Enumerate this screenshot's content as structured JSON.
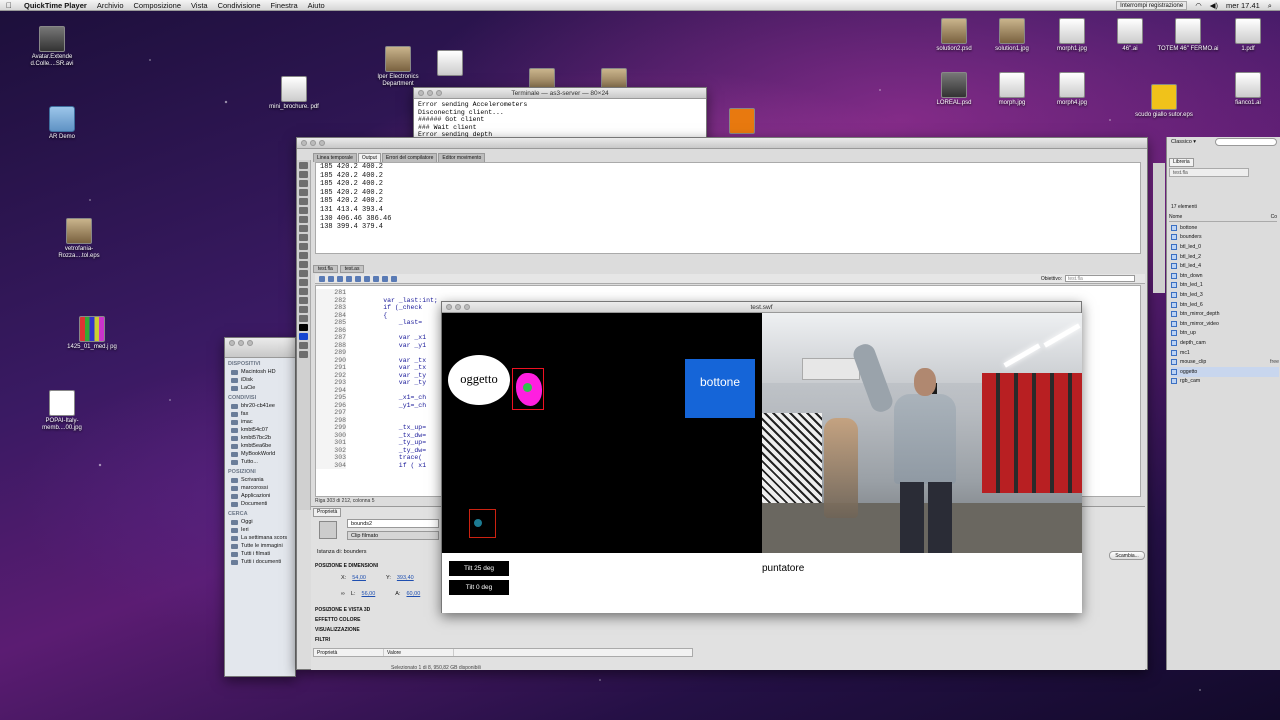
{
  "menubar": {
    "app": "QuickTime Player",
    "items": [
      "Archivio",
      "Composizione",
      "Vista",
      "Condivisione",
      "Finestra",
      "Aiuto"
    ],
    "notice": "Interrompi registrazione",
    "clock": "mer 17.41"
  },
  "desktop_icons": [
    {
      "label": "Avatar.Extende d.Colle....SR.avi"
    },
    {
      "label": "AR Demo"
    },
    {
      "label": "mini_brochure. pdf"
    },
    {
      "label": "Iper Electronics Department"
    },
    {
      "label": "vetrofania-Rozza....tol.eps"
    },
    {
      "label": "1425_01_med.j pg"
    },
    {
      "label": "POPAI-Italy-memb....00.jpg"
    },
    {
      "label": "solution2.psd"
    },
    {
      "label": "solution1.jpg"
    },
    {
      "label": "morph1.jpg"
    },
    {
      "label": "46\".ai"
    },
    {
      "label": "TOTEM 46\" FERMO.ai"
    },
    {
      "label": "1.pdf"
    },
    {
      "label": "LOREAL.psd"
    },
    {
      "label": "morph.jpg"
    },
    {
      "label": "morph4.jpg"
    },
    {
      "label": "scudo giallo sutor.eps"
    },
    {
      "label": "fianco1.ai"
    }
  ],
  "terminal": {
    "title": "Terminale — as3-server — 80×24",
    "lines": "Error sending Accelerometers\nDisconecting client...\n###### Got client\n### Wait client\nError sending depth"
  },
  "finder": {
    "sections": [
      {
        "title": "DISPOSITIVI",
        "items": [
          "Macintosh HD",
          "iDisk",
          "LaCie"
        ]
      },
      {
        "title": "CONDIVISI",
        "items": [
          "bhr20-cb41ee",
          "fax",
          "imac",
          "kmbt54c07",
          "kmbt57bc2b",
          "kmbt5ea6be",
          "MyBookWorld",
          "Tutto..."
        ]
      },
      {
        "title": "POSIZIONI",
        "items": [
          "Scrivania",
          "marcorossi",
          "Applicazioni",
          "Documenti"
        ]
      },
      {
        "title": "CERCA",
        "items": [
          "Oggi",
          "Ieri",
          "La settimana scors",
          "Tutte le immagini",
          "Tutti i filmati",
          "Tutti i documenti"
        ]
      }
    ]
  },
  "flash": {
    "panel_tabs": [
      "Linea temporale",
      "Output",
      "Errori del compilatore",
      "Editor movimento"
    ],
    "output": "185 420.2 400.2\n185 420.2 400.2\n185 420.2 400.2\n185 420.2 400.2\n185 420.2 400.2\n131 413.4 393.4\n130 406.46 386.46\n138 399.4 379.4",
    "doc_tabs": [
      "test.fla",
      "test.as"
    ],
    "target_label": "Obiettivo:",
    "target_value": "test.fla",
    "line_numbers": "281\n282\n283\n284\n285\n286\n287\n288\n289\n290\n291\n292\n293\n294\n295\n296\n297\n298\n299\n300\n301\n302\n303\n304",
    "code": "\n        var _last:int;\n        if (_check\n        {\n            _last=\n\n            var _x1\n            var _y1\n\n            var _tx\n            var _tx\n            var _ty\n            var _ty\n\n            _x1=_ch\n            _y1=_ch\n\n\n            _tx_up=\n            _tx_dw=\n            _ty_up=\n            _ty_dw=\n            trace(\n            if ( x1",
    "status": "Riga 303 di 212, colonna 5",
    "props": {
      "tab": "Proprietà",
      "instance_name": "bounds2",
      "type": "Clip filmato",
      "instance_of_label": "Istanza di:",
      "instance_of": "bounders",
      "swap": "Scambia...",
      "sec_position": "POSIZIONE E DIMENSIONI",
      "x_label": "X:",
      "x_value": "54,00",
      "y_label": "Y:",
      "y_value": "393,40",
      "w_label": "L:",
      "w_value": "56,00",
      "h_label": "A:",
      "h_value": "60,00",
      "sec_3d": "POSIZIONE E VISTA 3D",
      "sec_color": "EFFETTO COLORE",
      "sec_display": "VISUALIZZAZIONE",
      "sec_filters": "FILTRI",
      "col_property": "Proprietà",
      "col_value": "Valore",
      "selected": "Selezionato 1 di 8, 950,82 GB disponibili"
    }
  },
  "library": {
    "workspace": "Classico ▾",
    "tab": "Libreria",
    "file": "test.fla",
    "count": "17 elementi",
    "col_name": "Nome",
    "col_link": "Co",
    "items": [
      {
        "name": "bottone",
        "extra": ""
      },
      {
        "name": "bounders",
        "extra": ""
      },
      {
        "name": "btl_led_0",
        "extra": ""
      },
      {
        "name": "btl_led_2",
        "extra": ""
      },
      {
        "name": "btl_led_4",
        "extra": ""
      },
      {
        "name": "btn_down",
        "extra": ""
      },
      {
        "name": "btn_led_1",
        "extra": ""
      },
      {
        "name": "btn_led_3",
        "extra": ""
      },
      {
        "name": "btn_led_6",
        "extra": ""
      },
      {
        "name": "btn_mirror_depth",
        "extra": ""
      },
      {
        "name": "btn_mirror_video",
        "extra": ""
      },
      {
        "name": "btn_up",
        "extra": ""
      },
      {
        "name": "depth_cam",
        "extra": ""
      },
      {
        "name": "mc1",
        "extra": ""
      },
      {
        "name": "mouse_clip",
        "extra": "free"
      },
      {
        "name": "oggetto",
        "extra": ""
      },
      {
        "name": "rgb_cam",
        "extra": ""
      }
    ]
  },
  "swf": {
    "title": "test.swf",
    "oggetto": "oggetto",
    "bottone": "bottone",
    "tilt1": "Tilt 25 deg",
    "tilt2": "Tilt 0 deg",
    "puntatore": "puntatore"
  }
}
